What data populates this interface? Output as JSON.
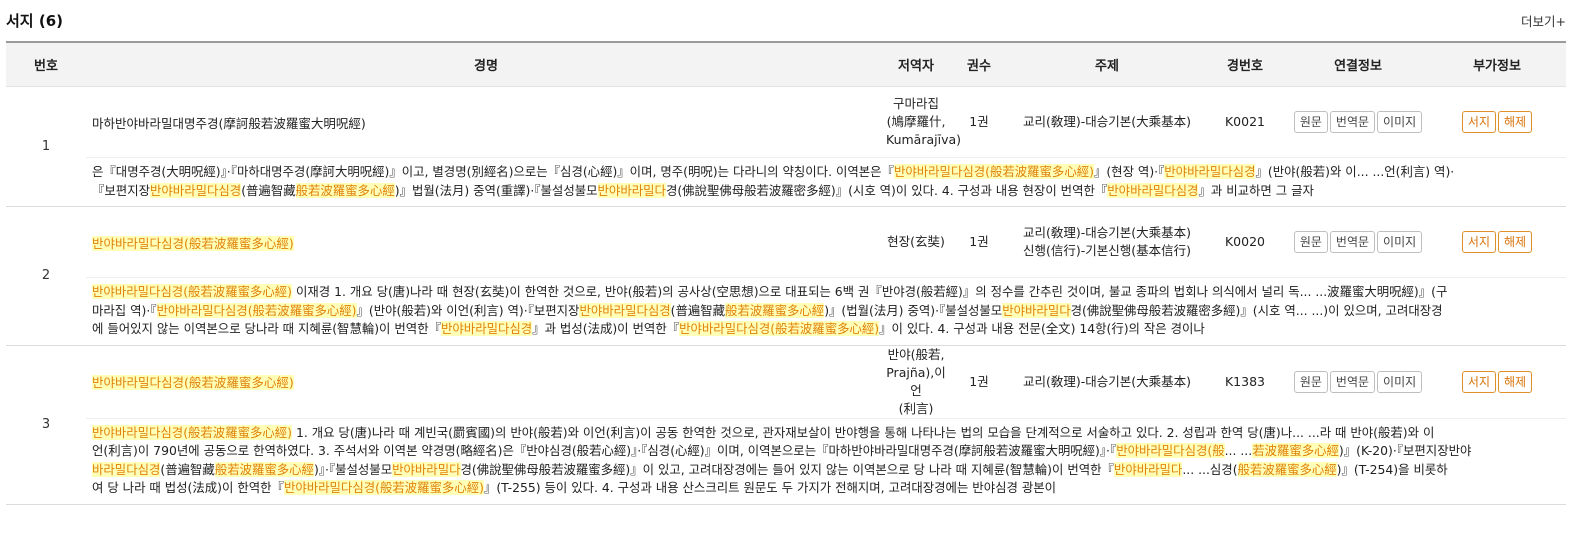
{
  "header": {
    "title": "서지",
    "count": "(6)",
    "more": "더보기+"
  },
  "columns": [
    "번호",
    "경명",
    "저역자",
    "권수",
    "주제",
    "경번호",
    "연결정보",
    "부가정보"
  ],
  "buttons": {
    "orig": "원문",
    "trans": "번역문",
    "image": "이미지",
    "bib": "서지",
    "expl": "해제"
  },
  "rows": [
    {
      "num": "1",
      "name": "마하반야바라밀대명주경(摩訶般若波羅蜜大明呪經)",
      "translator_lines": [
        "구마라집",
        "(鳩摩羅什,",
        "Kumārajīva)"
      ],
      "volume": "1권",
      "subject_lines": [
        "교리(敎理)-대승기본(大乘基本)"
      ],
      "code": "K0021",
      "desc_lines": [
        "은『대명주경(大明呪經)』·『마하대명주경(摩訶大明呪經)』이고, 별경명(別經名)으로는『심경(心經)』이며, 명주(明呪)는 다라니의 약칭이다. 이역본은『반야바라밀다심경(般若波羅蜜多心經)』(현장 역)·『반야바라밀다심경』(반야(般若)와 이... ...언(利言) 역)·",
        "『보편지장반야바라밀다심경(普遍智藏般若波羅蜜多心經)』법월(法月) 중역(重譯)·『불설성불모반야바라밀다경(佛說聖佛母般若波羅密多經)』(시호 역)이 있다. 4. 구성과 내용 현장이 번역한『반야바라밀다심경』과 비교하면 그 글자"
      ]
    },
    {
      "num": "2",
      "name": "반야바라밀다심경(般若波羅蜜多心經)",
      "translator_lines": [
        "현장(玄奘)"
      ],
      "volume": "1권",
      "subject_lines": [
        "교리(敎理)-대승기본(大乘基本)",
        "신행(信行)-기본신행(基本信行)"
      ],
      "code": "K0020",
      "desc_lines": [
        "반야바라밀다심경(般若波羅蜜多心經) 이재경 1. 개요 당(唐)나라 때 현장(玄奘)이 한역한 것으로, 반야(般若)의 공사상(空思想)으로 대표되는 6백 권『반야경(般若經)』의 정수를 간추린 것이며, 불교 종파의 법회나 의식에서 널리 독... ...波羅蜜大明呪經)』(구",
        "마라집 역)·『반야바라밀다심경(般若波羅蜜多心經)』(반야(般若)와 이언(利言) 역)·『보편지장반야바라밀다심경(普遍智藏般若波羅蜜多心經)』(법월(法月) 중역)·『불설성불모반야바라밀다경(佛說聖佛母般若波羅密多經)』(시호 역... ...)이 있으며, 고려대장경",
        "에 들어있지 않는 이역본으로 당나라 때 지혜륜(智慧輪)이 번역한『반야바라밀다심경』과 법성(法成)이 번역한『반야바라밀다심경(般若波羅蜜多心經)』이 있다. 4. 구성과 내용 전문(全文) 14항(行)의 작은 경이나"
      ]
    },
    {
      "num": "3",
      "name": "반야바라밀다심경(般若波羅蜜多心經)",
      "translator_lines": [
        "반야(般若,",
        "Prajña),이언",
        "(利言)"
      ],
      "volume": "1권",
      "subject_lines": [
        "교리(敎理)-대승기본(大乘基本)"
      ],
      "code": "K1383",
      "desc_lines": [
        "반야바라밀다심경(般若波羅蜜多心經) 1. 개요 당(唐)나라 때 계빈국(罽賓國)의 반야(般若)와 이언(利言)이 공동 한역한 것으로, 관자재보살이 반야행을 통해 나타나는 법의 모습을 단계적으로 서술하고 있다. 2. 성립과 한역 당(唐)나... ...라 때 반야(般若)와 이",
        "언(利言)이 790년에 공동으로 한역하였다. 3. 주석서와 이역본 약경명(略經名)은『반야심경(般若心經)』·『심경(心經)』이며, 이역본으로는『마하반야바라밀대명주경(摩訶般若波羅蜜大明呪經)』·『반야바라밀다심경(般... ...若波羅蜜多心經)』(K-20)·『보편지장반야",
        "바라밀다심경(普遍智藏般若波羅蜜多心經)』·『불설성불모반야바라밀다경(佛說聖佛母般若波羅蜜多經)』이 있고, 고려대장경에는 들어 있지 않는 이역본으로 당 나라 때 지혜륜(智慧輪)이 번역한『반야바라밀다... ...심경(般若波羅蜜多心經)』(T-254)을 비롯하",
        "여 당 나라 때 법성(法成)이 한역한『반야바라밀다심경(般若波羅蜜多心經)』(T-255) 등이 있다. 4. 구성과 내용 산스크리트 원문도 두 가지가 전해지며, 고려대장경에는 반야심경 광본이"
      ]
    }
  ]
}
